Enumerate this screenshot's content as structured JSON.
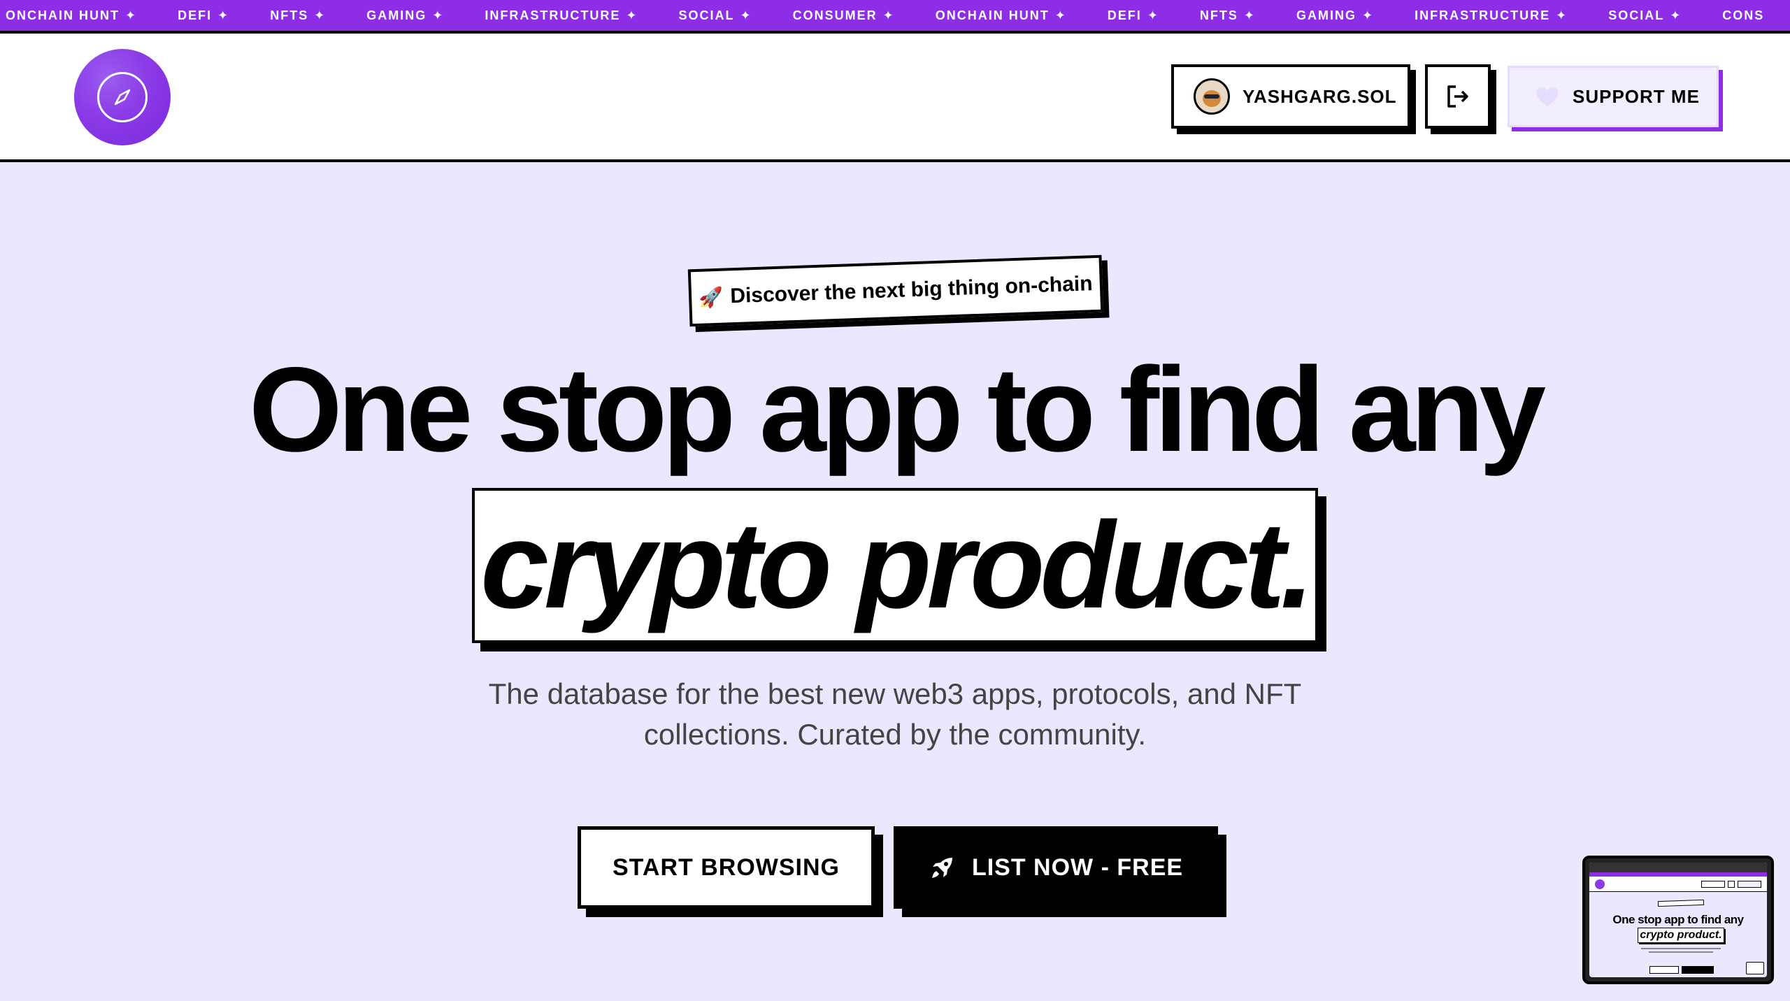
{
  "ticker": {
    "items": [
      "ONCHAIN HUNT",
      "DEFI",
      "NFTS",
      "GAMING",
      "INFRASTRUCTURE",
      "SOCIAL",
      "CONSUMER",
      "ONCHAIN HUNT",
      "DEFI",
      "NFTS",
      "GAMING",
      "INFRASTRUCTURE",
      "SOCIAL",
      "CONS"
    ],
    "separator": "✦"
  },
  "header": {
    "logo_icon": "compass-icon",
    "user_label": "YASHGARG.SOL",
    "logout_icon": "logout-icon",
    "support_label": "SUPPORT ME",
    "support_icon": "heart-icon"
  },
  "hero": {
    "tagline_emoji": "🚀",
    "tagline": "Discover the next big thing on-chain",
    "headline_line1": "One stop app to find any",
    "headline_line2": "crypto product.",
    "subtitle": "The database for the best new web3 apps, protocols, and NFT collections. Curated by the community.",
    "primary_button": "START BROWSING",
    "secondary_button": "LIST NOW - FREE",
    "secondary_icon": "rocket-icon"
  },
  "preview": {
    "headline_line1": "One stop app to find any",
    "headline_line2": "crypto product."
  },
  "colors": {
    "accent": "#8d2ee6",
    "background": "#ece7fe",
    "ink": "#000000"
  }
}
